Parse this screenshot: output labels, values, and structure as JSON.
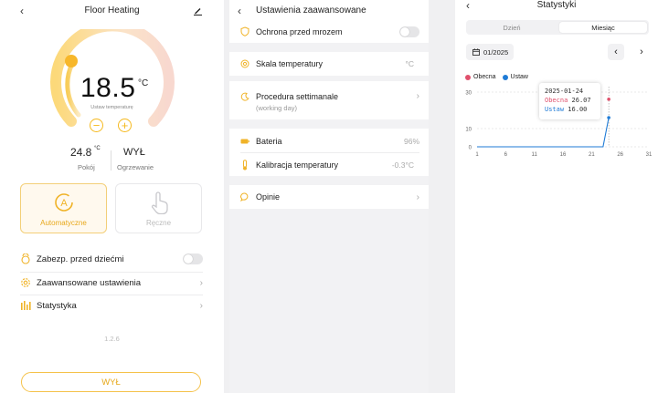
{
  "colors": {
    "accent": "#f5b91e",
    "blue": "#1f7bd6",
    "red": "#e0506c",
    "grey_text": "#999999"
  },
  "screen1": {
    "title": "Floor Heating",
    "set_temp": "18.5",
    "set_unit": "°C",
    "set_label": "Ustaw temperaturę",
    "room_temp": "24.8",
    "room_unit": "°C",
    "room_label": "Pokój",
    "heating_status": "WYŁ",
    "heating_label": "Ogrzewanie",
    "mode_auto_label": "Automatyczne",
    "mode_manual_label": "Ręczne",
    "child_lock_label": "Zabezp. przed dziećmi",
    "advanced_label": "Zaawansowane ustawienia",
    "stats_label": "Statystyka",
    "version": "1.2.6",
    "power_button_label": "WYŁ"
  },
  "screen2": {
    "title": "Ustawienia zaawansowane",
    "frost_label": "Ochrona przed mrozem",
    "scale_label": "Skala temperatury",
    "scale_value": "°C",
    "procedure_label": "Procedura settimanale",
    "procedure_sub": "(working day)",
    "battery_label": "Bateria",
    "battery_value": "96%",
    "calib_label": "Kalibracja temperatury",
    "calib_value": "-0.3°C",
    "feedback_label": "Opinie"
  },
  "screen3": {
    "title": "Statystyki",
    "tab_day": "Dzień",
    "tab_month": "Miesiąc",
    "date_label": "01/2025",
    "legend_current": "Obecna",
    "legend_set": "Ustaw",
    "tooltip_date": "2025-01-24",
    "tooltip_current_label": "Obecna",
    "tooltip_current_value": "26.07",
    "tooltip_set_label": "Ustaw",
    "tooltip_set_value": "16.00"
  },
  "chart_data": {
    "type": "line",
    "x": [
      1,
      2,
      3,
      4,
      5,
      6,
      7,
      8,
      9,
      10,
      11,
      12,
      13,
      14,
      15,
      16,
      17,
      18,
      19,
      20,
      21,
      22,
      23,
      24
    ],
    "x_ticks": [
      "1",
      "6",
      "11",
      "16",
      "21",
      "26",
      "31"
    ],
    "y_ticks": [
      "0",
      "10",
      "30"
    ],
    "ylim": [
      0,
      30
    ],
    "xlim": [
      1,
      31
    ],
    "series": [
      {
        "name": "Obecna",
        "color": "#e0506c",
        "points": [
          [
            24,
            26.07
          ]
        ]
      },
      {
        "name": "Ustaw",
        "color": "#1f7bd6",
        "values": [
          0,
          0,
          0,
          0,
          0,
          0,
          0,
          0,
          0,
          0,
          0,
          0,
          0,
          0,
          0,
          0,
          0,
          0,
          0,
          0,
          0,
          0,
          0,
          16
        ]
      }
    ],
    "highlight_x": 24,
    "legend": "top-left",
    "grid": "horizontal-dashed"
  }
}
